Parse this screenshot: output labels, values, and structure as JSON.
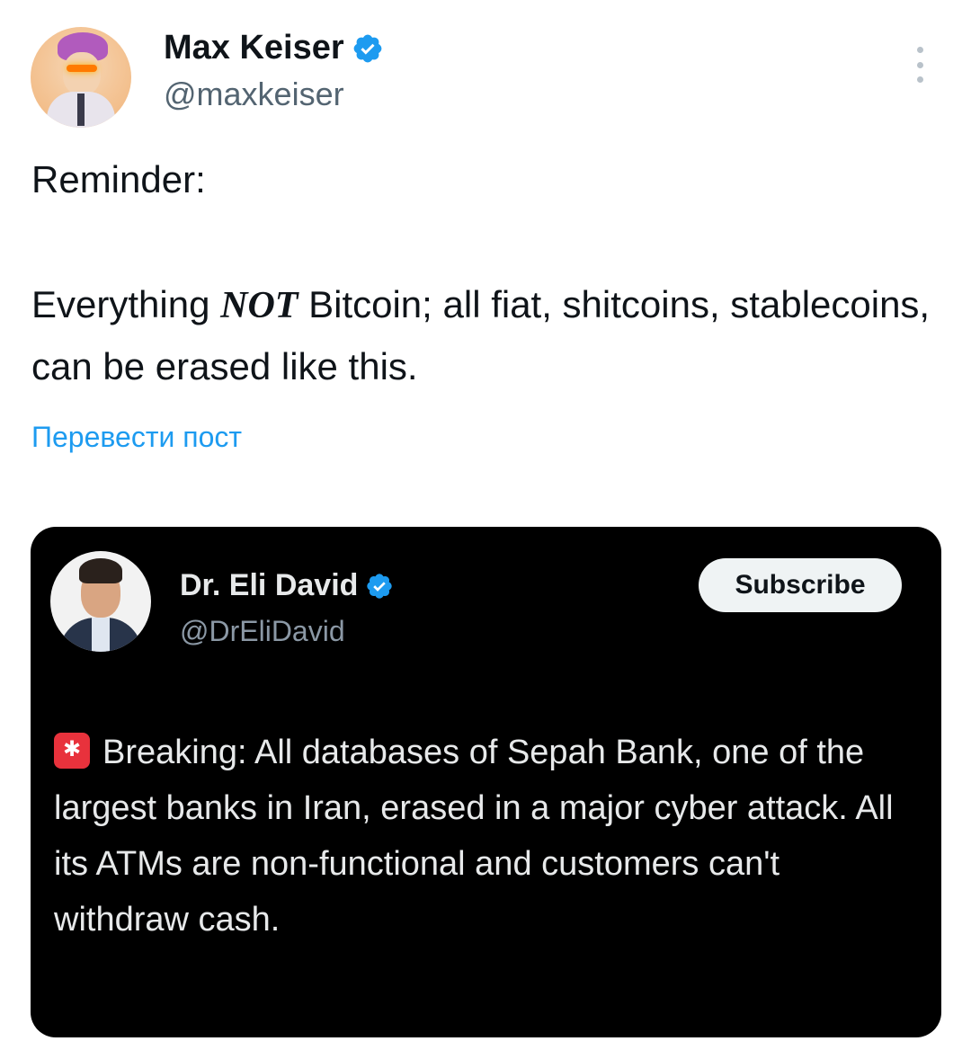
{
  "post": {
    "author_name": "Max Keiser",
    "author_handle": "@maxkeiser",
    "verified_icon": "verified-badge-icon",
    "more_icon": "more-options-icon",
    "text_line1": "Reminder:",
    "text_main_before": "Everything ",
    "text_main_emphasis": "NOT",
    "text_main_after": " Bitcoin; all fiat, shitcoins, stablecoins, can be erased like this.",
    "translate_label": "Перевести пост"
  },
  "quoted": {
    "author_name": "Dr. Eli David",
    "author_handle": "@DrEliDavid",
    "subscribe_label": "Subscribe",
    "siren_icon": "rotating-light-icon",
    "text": "Breaking: All databases of Sepah Bank, one of the largest banks in Iran, erased in a major cyber attack. All its ATMs are non-functional and customers can't withdraw cash."
  },
  "colors": {
    "link": "#1d9bf0",
    "verified": "#1d9bf0",
    "card_bg": "#000000"
  }
}
